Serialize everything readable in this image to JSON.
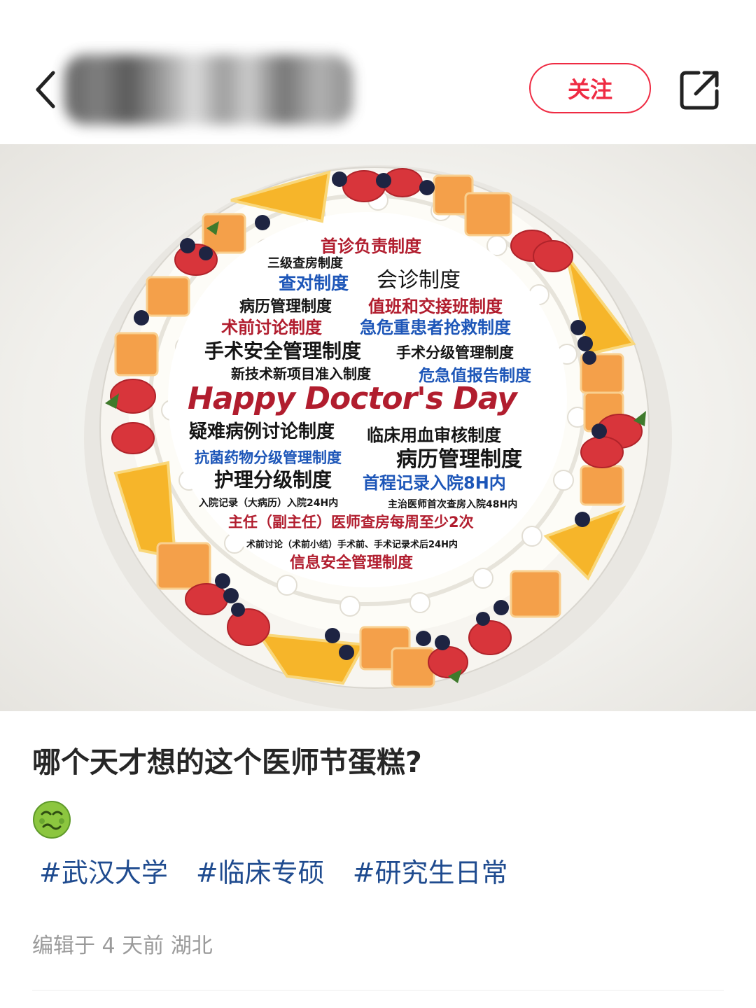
{
  "header": {
    "author_name": "",
    "follow_label": "关注",
    "back_icon": "chevron-left-icon",
    "share_icon": "share-icon",
    "accent_color": "#ef2b43"
  },
  "cake": {
    "headline": "Happy Doctor's Day",
    "lines": [
      "首诊负责制度",
      "三级查房制度",
      "查对制度",
      "会诊制度",
      "病历管理制度",
      "值班和交接班制度",
      "术前讨论制度",
      "急危重患者抢救制度",
      "手术安全管理制度",
      "手术分级管理制度",
      "新技术新项目准入制度",
      "危急值报告制度",
      "疑难病例讨论制度",
      "临床用血审核制度",
      "抗菌药物分级管理制度",
      "病历管理制度",
      "护理分级制度",
      "首程记录入院8H内",
      "入院记录（大病历）入院24H内",
      "主治医师首次查房入院48H内",
      "主任（副主任）医师查房每周至少2次",
      "术前讨论（术前小结）手术前、手术记录术后24H内",
      "信息安全管理制度"
    ]
  },
  "post": {
    "title": "哪个天才想的这个医师节蛋糕?",
    "emoji": "nauseated-face-emoji",
    "tags": [
      "#武汉大学",
      "#临床专硕",
      "#研究生日常"
    ],
    "meta": "编辑于 4 天前 湖北"
  }
}
